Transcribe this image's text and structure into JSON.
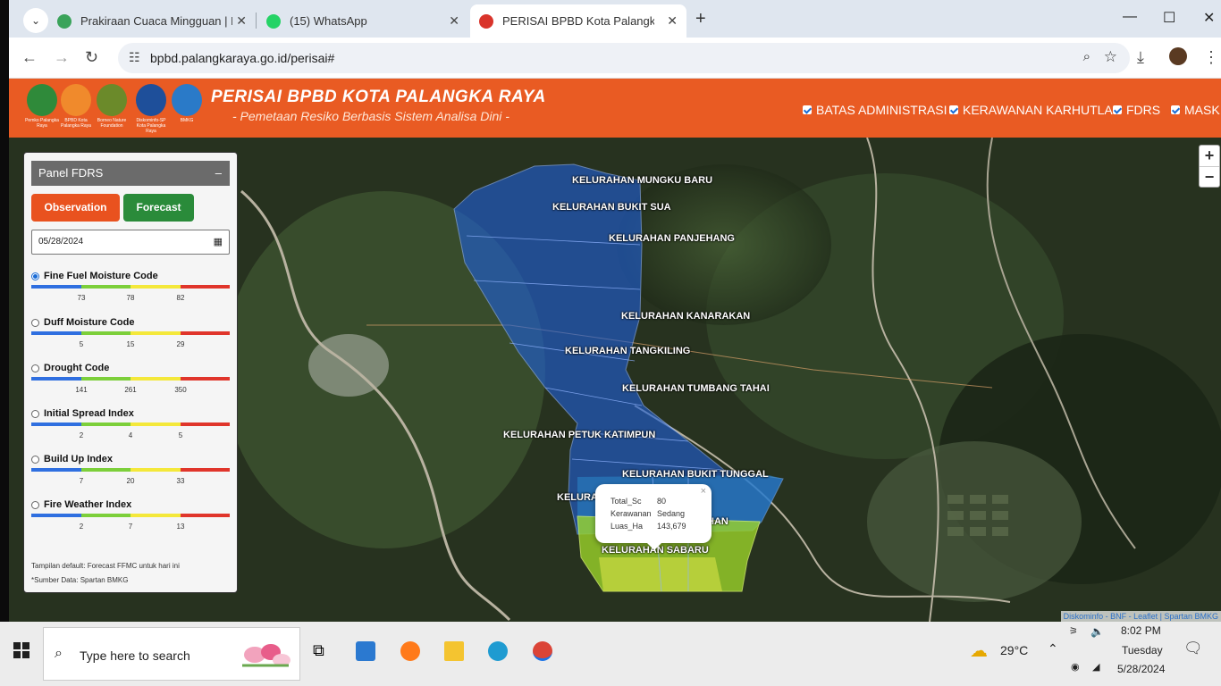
{
  "browser": {
    "tabs": [
      {
        "label": "Prakiraan Cuaca Mingguan | BMKG",
        "favicon_color": "#3aa35a"
      },
      {
        "label": "(15) WhatsApp",
        "favicon_color": "#25d366"
      },
      {
        "label": "PERISAI BPBD Kota Palangka Raya",
        "favicon_color": "#d9342b"
      }
    ],
    "url": "bpbd.palangkaraya.go.id/perisai#"
  },
  "site": {
    "title": "PERISAI BPBD KOTA PALANGKA RAYA",
    "subtitle": "- Pemetaan Resiko Berbasis Sistem Analisa Dini -",
    "logos": [
      {
        "caption": "Pemko Palangka Raya",
        "color": "#2f8a3a"
      },
      {
        "caption": "BPBD Kota Palangka Raya",
        "color": "#f08a2c"
      },
      {
        "caption": "Borneo Nature Foundation",
        "color": "#6b8a2a"
      },
      {
        "caption": "Diskominfo-SP Kota Palangka Raya",
        "color": "#1e4f9a"
      },
      {
        "caption": "BMKG",
        "color": "#2a7ac8"
      }
    ],
    "layers": [
      "BATAS ADMINISTRASI",
      "KERAWANAN KARHUTLA",
      "FDRS",
      "MASK"
    ]
  },
  "panel": {
    "title": "Panel FDRS",
    "minimize": "–",
    "observation": "Observation",
    "forecast": "Forecast",
    "date": "05/28/2024",
    "indices": [
      {
        "name": "Fine Fuel Moisture Code",
        "selected": true,
        "ticks": [
          "73",
          "78",
          "82"
        ]
      },
      {
        "name": "Duff Moisture Code",
        "selected": false,
        "ticks": [
          "5",
          "15",
          "29"
        ]
      },
      {
        "name": "Drought Code",
        "selected": false,
        "ticks": [
          "141",
          "261",
          "350"
        ]
      },
      {
        "name": "Initial Spread Index",
        "selected": false,
        "ticks": [
          "2",
          "4",
          "5"
        ]
      },
      {
        "name": "Build Up Index",
        "selected": false,
        "ticks": [
          "7",
          "20",
          "33"
        ]
      },
      {
        "name": "Fire Weather Index",
        "selected": false,
        "ticks": [
          "2",
          "7",
          "13"
        ]
      }
    ],
    "scale_colors": [
      "#2f6fe0",
      "#7ccf3a",
      "#f4e83a",
      "#e0352b"
    ],
    "note1": "Tampilan default: Forecast FFMC untuk hari ini",
    "note2": "*Sumber Data: Spartan BMKG"
  },
  "map": {
    "zoom_in": "+",
    "zoom_out": "−",
    "kelurahan": [
      "KELURAHAN MUNGKU BARU",
      "KELURAHAN BUKIT SUA",
      "KELURAHAN PANJEHANG",
      "KELURAHAN KANARAKAN",
      "KELURAHAN TANGKILING",
      "KELURAHAN TUMBANG TAHAI",
      "KELURAHAN PETUK KATIMPUN",
      "KELURAHAN BUKIT TUNGGAL",
      "KELURA",
      "HAN",
      "KELURAHAN SABARU"
    ],
    "popup": {
      "close": "×",
      "rows": [
        {
          "key": "Total_Sc",
          "value": "80"
        },
        {
          "key": "Kerawanan",
          "value": "Sedang"
        },
        {
          "key": "Luas_Ha",
          "value": "143,679"
        }
      ]
    },
    "attribution": "Diskominfo - BNF - Leaflet | Spartan BMKG"
  },
  "taskbar": {
    "search_placeholder": "Type here to search",
    "weather": "29°C",
    "time": "8:02 PM",
    "day": "Tuesday",
    "date": "5/28/2024"
  }
}
